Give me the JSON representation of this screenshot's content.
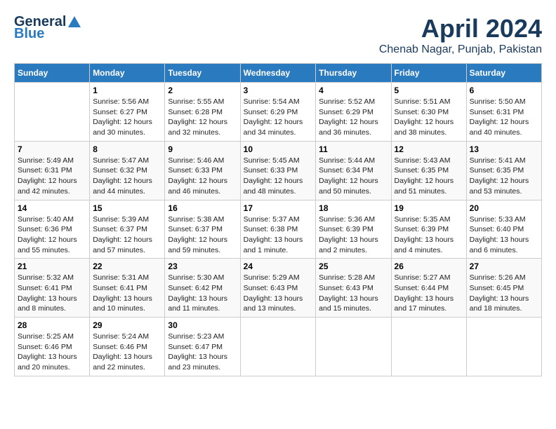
{
  "header": {
    "logo_general": "General",
    "logo_blue": "Blue",
    "title": "April 2024",
    "subtitle": "Chenab Nagar, Punjab, Pakistan"
  },
  "columns": [
    "Sunday",
    "Monday",
    "Tuesday",
    "Wednesday",
    "Thursday",
    "Friday",
    "Saturday"
  ],
  "weeks": [
    [
      {
        "day": "",
        "sunrise": "",
        "sunset": "",
        "daylight": ""
      },
      {
        "day": "1",
        "sunrise": "Sunrise: 5:56 AM",
        "sunset": "Sunset: 6:27 PM",
        "daylight": "Daylight: 12 hours and 30 minutes."
      },
      {
        "day": "2",
        "sunrise": "Sunrise: 5:55 AM",
        "sunset": "Sunset: 6:28 PM",
        "daylight": "Daylight: 12 hours and 32 minutes."
      },
      {
        "day": "3",
        "sunrise": "Sunrise: 5:54 AM",
        "sunset": "Sunset: 6:29 PM",
        "daylight": "Daylight: 12 hours and 34 minutes."
      },
      {
        "day": "4",
        "sunrise": "Sunrise: 5:52 AM",
        "sunset": "Sunset: 6:29 PM",
        "daylight": "Daylight: 12 hours and 36 minutes."
      },
      {
        "day": "5",
        "sunrise": "Sunrise: 5:51 AM",
        "sunset": "Sunset: 6:30 PM",
        "daylight": "Daylight: 12 hours and 38 minutes."
      },
      {
        "day": "6",
        "sunrise": "Sunrise: 5:50 AM",
        "sunset": "Sunset: 6:31 PM",
        "daylight": "Daylight: 12 hours and 40 minutes."
      }
    ],
    [
      {
        "day": "7",
        "sunrise": "Sunrise: 5:49 AM",
        "sunset": "Sunset: 6:31 PM",
        "daylight": "Daylight: 12 hours and 42 minutes."
      },
      {
        "day": "8",
        "sunrise": "Sunrise: 5:47 AM",
        "sunset": "Sunset: 6:32 PM",
        "daylight": "Daylight: 12 hours and 44 minutes."
      },
      {
        "day": "9",
        "sunrise": "Sunrise: 5:46 AM",
        "sunset": "Sunset: 6:33 PM",
        "daylight": "Daylight: 12 hours and 46 minutes."
      },
      {
        "day": "10",
        "sunrise": "Sunrise: 5:45 AM",
        "sunset": "Sunset: 6:33 PM",
        "daylight": "Daylight: 12 hours and 48 minutes."
      },
      {
        "day": "11",
        "sunrise": "Sunrise: 5:44 AM",
        "sunset": "Sunset: 6:34 PM",
        "daylight": "Daylight: 12 hours and 50 minutes."
      },
      {
        "day": "12",
        "sunrise": "Sunrise: 5:43 AM",
        "sunset": "Sunset: 6:35 PM",
        "daylight": "Daylight: 12 hours and 51 minutes."
      },
      {
        "day": "13",
        "sunrise": "Sunrise: 5:41 AM",
        "sunset": "Sunset: 6:35 PM",
        "daylight": "Daylight: 12 hours and 53 minutes."
      }
    ],
    [
      {
        "day": "14",
        "sunrise": "Sunrise: 5:40 AM",
        "sunset": "Sunset: 6:36 PM",
        "daylight": "Daylight: 12 hours and 55 minutes."
      },
      {
        "day": "15",
        "sunrise": "Sunrise: 5:39 AM",
        "sunset": "Sunset: 6:37 PM",
        "daylight": "Daylight: 12 hours and 57 minutes."
      },
      {
        "day": "16",
        "sunrise": "Sunrise: 5:38 AM",
        "sunset": "Sunset: 6:37 PM",
        "daylight": "Daylight: 12 hours and 59 minutes."
      },
      {
        "day": "17",
        "sunrise": "Sunrise: 5:37 AM",
        "sunset": "Sunset: 6:38 PM",
        "daylight": "Daylight: 13 hours and 1 minute."
      },
      {
        "day": "18",
        "sunrise": "Sunrise: 5:36 AM",
        "sunset": "Sunset: 6:39 PM",
        "daylight": "Daylight: 13 hours and 2 minutes."
      },
      {
        "day": "19",
        "sunrise": "Sunrise: 5:35 AM",
        "sunset": "Sunset: 6:39 PM",
        "daylight": "Daylight: 13 hours and 4 minutes."
      },
      {
        "day": "20",
        "sunrise": "Sunrise: 5:33 AM",
        "sunset": "Sunset: 6:40 PM",
        "daylight": "Daylight: 13 hours and 6 minutes."
      }
    ],
    [
      {
        "day": "21",
        "sunrise": "Sunrise: 5:32 AM",
        "sunset": "Sunset: 6:41 PM",
        "daylight": "Daylight: 13 hours and 8 minutes."
      },
      {
        "day": "22",
        "sunrise": "Sunrise: 5:31 AM",
        "sunset": "Sunset: 6:41 PM",
        "daylight": "Daylight: 13 hours and 10 minutes."
      },
      {
        "day": "23",
        "sunrise": "Sunrise: 5:30 AM",
        "sunset": "Sunset: 6:42 PM",
        "daylight": "Daylight: 13 hours and 11 minutes."
      },
      {
        "day": "24",
        "sunrise": "Sunrise: 5:29 AM",
        "sunset": "Sunset: 6:43 PM",
        "daylight": "Daylight: 13 hours and 13 minutes."
      },
      {
        "day": "25",
        "sunrise": "Sunrise: 5:28 AM",
        "sunset": "Sunset: 6:43 PM",
        "daylight": "Daylight: 13 hours and 15 minutes."
      },
      {
        "day": "26",
        "sunrise": "Sunrise: 5:27 AM",
        "sunset": "Sunset: 6:44 PM",
        "daylight": "Daylight: 13 hours and 17 minutes."
      },
      {
        "day": "27",
        "sunrise": "Sunrise: 5:26 AM",
        "sunset": "Sunset: 6:45 PM",
        "daylight": "Daylight: 13 hours and 18 minutes."
      }
    ],
    [
      {
        "day": "28",
        "sunrise": "Sunrise: 5:25 AM",
        "sunset": "Sunset: 6:46 PM",
        "daylight": "Daylight: 13 hours and 20 minutes."
      },
      {
        "day": "29",
        "sunrise": "Sunrise: 5:24 AM",
        "sunset": "Sunset: 6:46 PM",
        "daylight": "Daylight: 13 hours and 22 minutes."
      },
      {
        "day": "30",
        "sunrise": "Sunrise: 5:23 AM",
        "sunset": "Sunset: 6:47 PM",
        "daylight": "Daylight: 13 hours and 23 minutes."
      },
      {
        "day": "",
        "sunrise": "",
        "sunset": "",
        "daylight": ""
      },
      {
        "day": "",
        "sunrise": "",
        "sunset": "",
        "daylight": ""
      },
      {
        "day": "",
        "sunrise": "",
        "sunset": "",
        "daylight": ""
      },
      {
        "day": "",
        "sunrise": "",
        "sunset": "",
        "daylight": ""
      }
    ]
  ]
}
